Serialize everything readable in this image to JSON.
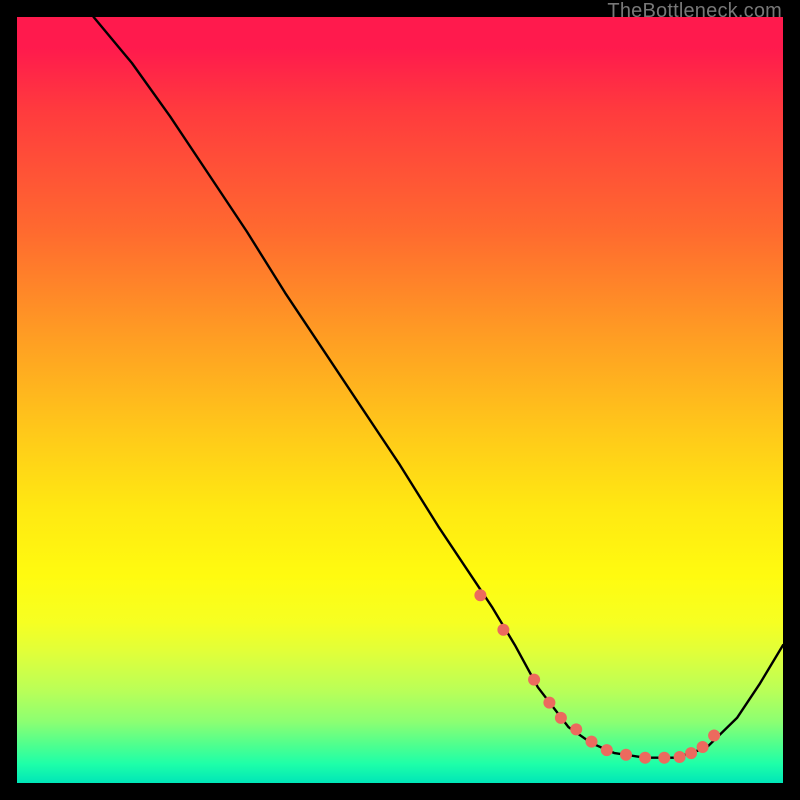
{
  "watermark": "TheBottleneck.com",
  "colors": {
    "curve": "#000000",
    "dots": "#ec6a5e",
    "gradient_top": "#ff1a4d",
    "gradient_bottom": "#00e6b8"
  },
  "chart_data": {
    "type": "line",
    "title": "",
    "xlabel": "",
    "ylabel": "",
    "xlim": [
      0,
      100
    ],
    "ylim": [
      0,
      100
    ],
    "grid": false,
    "legend": false,
    "note": "Bottleneck-style curve; y is relative height (100=top of plot, 0=bottom). Values read approximately from pixel positions.",
    "series": [
      {
        "name": "curve",
        "x": [
          10,
          15,
          20,
          25,
          30,
          35,
          40,
          45,
          50,
          55,
          60,
          62,
          65,
          68,
          72,
          75,
          78,
          82,
          86,
          90,
          94,
          97,
          100
        ],
        "y": [
          100,
          94,
          87,
          79.5,
          72,
          64,
          56.5,
          49,
          41.5,
          33.5,
          26,
          23,
          18,
          12.5,
          7.3,
          5.2,
          3.9,
          3.3,
          3.3,
          4.6,
          8.5,
          13,
          18
        ]
      }
    ],
    "dots": {
      "name": "highlight-dots",
      "x": [
        60.5,
        63.5,
        67.5,
        69.5,
        71,
        73,
        75,
        77,
        79.5,
        82,
        84.5,
        86.5,
        88,
        89.5,
        91
      ],
      "y": [
        24.5,
        20,
        13.5,
        10.5,
        8.5,
        7,
        5.4,
        4.3,
        3.7,
        3.3,
        3.3,
        3.4,
        3.9,
        4.7,
        6.2
      ]
    }
  }
}
